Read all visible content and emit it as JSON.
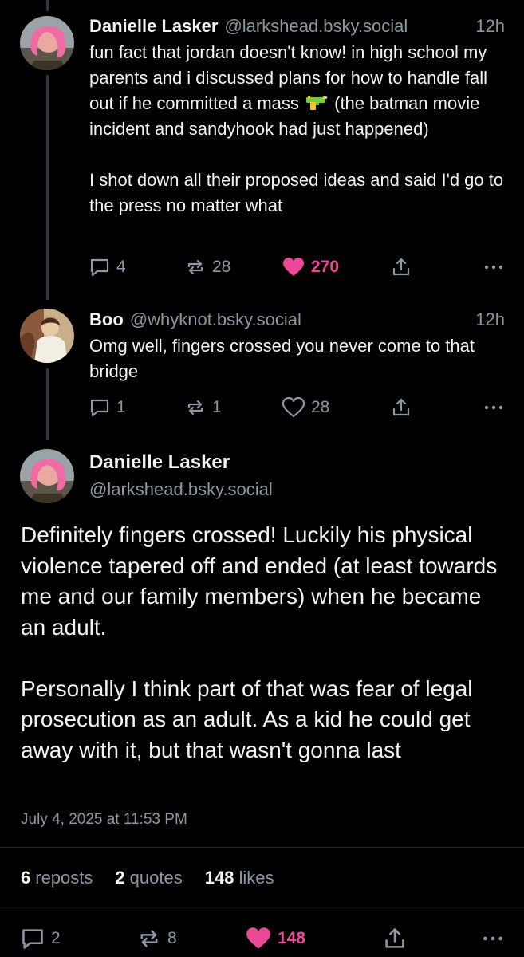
{
  "thread": [
    {
      "author": {
        "name": "Danielle Lasker",
        "handle": "@larkshead.bsky.social"
      },
      "time": "12h",
      "text_before_emoji": "fun fact that jordan doesn't know! in high school my parents and i discussed plans for how to handle fall out if he committed a mass ",
      "emoji_name": "gun-emoji",
      "text_after_emoji": " (the batman movie incident and sandyhook had just happened)\n\nI shot down all their proposed ideas and said I'd go to the press no matter what",
      "counts": {
        "replies": "4",
        "reposts": "28",
        "likes": "270"
      },
      "liked": true
    },
    {
      "author": {
        "name": "Boo",
        "handle": "@whyknot.bsky.social"
      },
      "time": "12h",
      "text": "Omg well, fingers crossed you never come to that bridge",
      "counts": {
        "replies": "1",
        "reposts": "1",
        "likes": "28"
      },
      "liked": false
    }
  ],
  "focus_post": {
    "author": {
      "name": "Danielle Lasker",
      "handle": "@larkshead.bsky.social"
    },
    "text": "Definitely fingers crossed! Luckily his physical violence tapered off and ended (at least towards me and our family members) when he became an adult.\n\nPersonally I think part of that was fear of legal prosecution as an adult. As a kid he could get away with it, but that wasn't gonna last",
    "date": "July 4, 2025 at 11:53 PM",
    "stats": {
      "reposts_count": "6",
      "reposts_label": "reposts",
      "quotes_count": "2",
      "quotes_label": "quotes",
      "likes_count": "148",
      "likes_label": "likes"
    },
    "counts": {
      "replies": "2",
      "reposts": "8",
      "likes": "148"
    },
    "liked": true
  },
  "icons": {
    "reply": "speech-bubble-icon",
    "repost": "repost-arrows-icon",
    "like": "heart-icon",
    "share": "share-upload-icon",
    "more": "ellipsis-icon"
  },
  "colors": {
    "background": "#000000",
    "text": "#f1f3f5",
    "muted": "#8b98a5",
    "like": "#ec4899",
    "thread_line": "#2e3845"
  }
}
